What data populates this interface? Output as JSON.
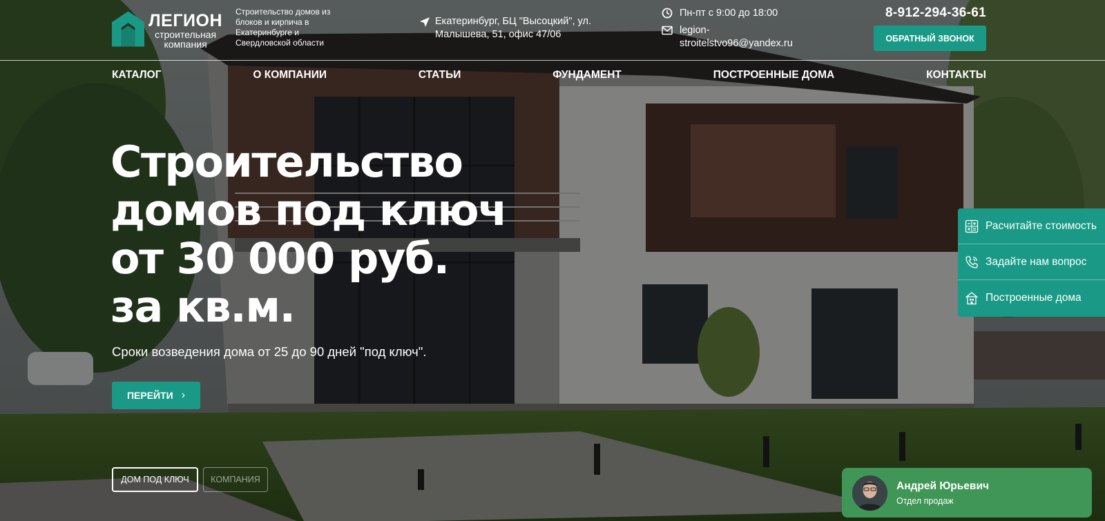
{
  "colors": {
    "accent": "#1a9a86",
    "chat": "#3f9656",
    "text": "#ffffff"
  },
  "header": {
    "logo_name": "ЛЕГИОН",
    "logo_sub_1": "строительная",
    "logo_sub_2": "компания",
    "tagline": "Строительство домов из блоков и кирпича в Екатеринбурге и Свердловской области",
    "address": "Екатеринбург, БЦ \"Высоцкий\", ул. Малышева, 51, офис 47/06",
    "hours": "Пн-пт с 9:00 до 18:00",
    "email": "legion-stroitelstvo96@yandex.ru",
    "phone": "8-912-294-36-61",
    "callback_label": "ОБРАТНЫЙ ЗВОНОК",
    "icons": {
      "address": "location-arrow-icon",
      "hours": "clock-icon",
      "email": "envelope-icon"
    }
  },
  "nav": {
    "items": [
      {
        "label": "КАТАЛОГ"
      },
      {
        "label": "О КОМПАНИИ"
      },
      {
        "label": "СТАТЬИ"
      },
      {
        "label": "ФУНДАМЕНТ"
      },
      {
        "label": "ПОСТРОЕННЫЕ ДОМА"
      },
      {
        "label": "КОНТАКТЫ"
      }
    ]
  },
  "hero": {
    "title_lines": [
      "Строительство",
      "домов под ключ",
      "от 30 000 руб.",
      "за кв.м."
    ],
    "subtitle": "Сроки возведения дома от 25 до 90 дней \"под ключ\".",
    "button_label": "ПЕРЕЙТИ",
    "button_chevron": "›",
    "tabs": [
      {
        "label": "ДОМ ПОД КЛЮЧ",
        "active": true
      },
      {
        "label": "КОМПАНИЯ",
        "active": false
      }
    ]
  },
  "side_panel": {
    "items": [
      {
        "label": "Расчитайте стоимость",
        "icon": "calculator-icon"
      },
      {
        "label": "Задайте нам вопрос",
        "icon": "phone-icon"
      },
      {
        "label": "Построенные дома",
        "icon": "house-icon"
      }
    ]
  },
  "chat": {
    "name": "Андрей Юрьевич",
    "role": "Отдел продаж"
  }
}
